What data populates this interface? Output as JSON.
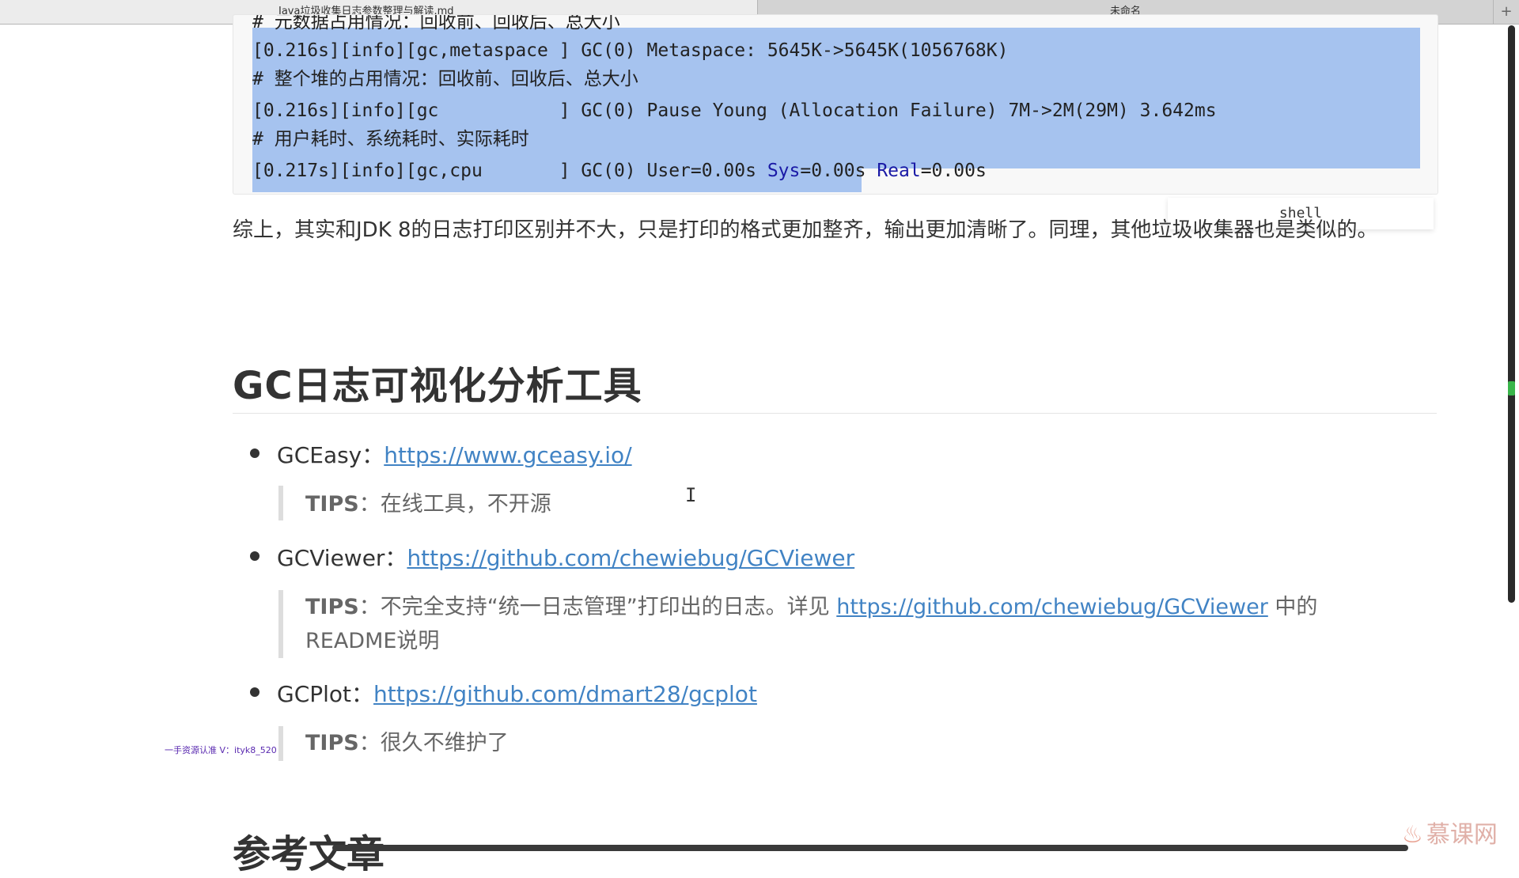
{
  "tabs": [
    {
      "label": "Java垃圾收集日志参数整理与解读.md",
      "active": true
    },
    {
      "label": "未命名",
      "active": false
    }
  ],
  "tab_add": "+",
  "code": {
    "lines": [
      "# 元数据占用情况：回收前、回收后、总大小",
      "[0.216s][info][gc,metaspace ] GC(0) Metaspace: 5645K->5645K(1056768K)",
      "# 整个堆的占用情况：回收前、回收后、总大小",
      "[0.216s][info][gc           ] GC(0) Pause Young (Allocation Failure) 7M->2M(29M) 3.642ms",
      "# 用户耗时、系统耗时、实际耗时",
      "[0.217s][info][gc,cpu       ] GC(0) User=0.00s ",
      "Sys",
      "=0.00s ",
      "Real",
      "=0.00s"
    ],
    "language": "shell"
  },
  "summary": "综上，其实和JDK 8的日志打印区别并不大，只是打印的格式更加整齐，输出更加清晰了。同理，其他垃圾收集器也是类似的。",
  "heading": "GC日志可视化分析工具",
  "tools": [
    {
      "name": "GCEasy：",
      "url": "https://www.gceasy.io/",
      "tips_label": "TIPS",
      "tips_text": "：在线工具，不开源"
    },
    {
      "name": "GCViewer：",
      "url": "https://github.com/chewiebug/GCViewer",
      "tips_label": "TIPS",
      "tips_text": "：不完全支持“统一日志管理”打印出的日志。详见 ",
      "tips_link": "https://github.com/chewiebug/GCViewer",
      "tips_tail": " 中的",
      "tips_line2": "README说明"
    },
    {
      "name": "GCPlot：",
      "url": "https://github.com/dmart28/gcplot",
      "tips_label": "TIPS",
      "tips_text": "：很久不维护了"
    }
  ],
  "next_heading": "参考文章",
  "watermark": "一手资源认准 V：ityk8_520",
  "brand": "慕课网",
  "colors": {
    "link": "#4183c4",
    "selection": "#a6c3ef",
    "keyword": "#1a1aa6"
  }
}
